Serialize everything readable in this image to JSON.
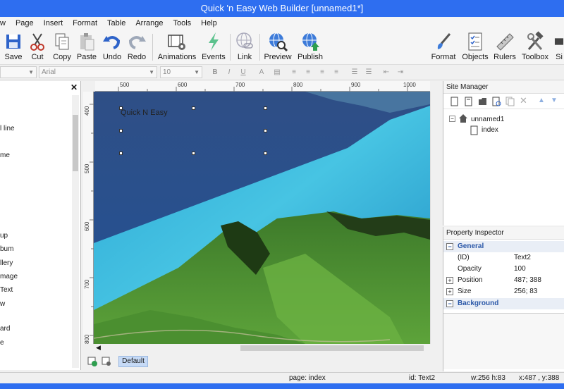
{
  "window": {
    "title": "Quick 'n Easy Web Builder [unnamed1*]"
  },
  "menu": [
    "w",
    "Page",
    "Insert",
    "Format",
    "Table",
    "Arrange",
    "Tools",
    "Help"
  ],
  "toolbar": {
    "save": "Save",
    "cut": "Cut",
    "copy": "Copy",
    "paste": "Paste",
    "undo": "Undo",
    "redo": "Redo",
    "animations": "Animations",
    "events": "Events",
    "link": "Link",
    "preview": "Preview",
    "publish": "Publish",
    "format": "Format",
    "objects": "Objects",
    "rulers": "Rulers",
    "toolbox": "Toolbox",
    "si": "Si"
  },
  "format_bar": {
    "font": "Arial",
    "size": "10"
  },
  "toolbox_items": [
    "l line",
    "me",
    "up",
    "bum",
    "llery",
    "mage",
    "Text",
    "w",
    "ard",
    "e"
  ],
  "rulers": {
    "top": [
      "500",
      "600",
      "700",
      "800",
      "900",
      "1000"
    ],
    "left": [
      "400",
      "500",
      "600",
      "700",
      "800"
    ]
  },
  "canvas": {
    "text": "Quick N Easy"
  },
  "bottom": {
    "default_tab": "Default"
  },
  "site_manager": {
    "title": "Site Manager",
    "root": "unnamed1",
    "page": "index"
  },
  "property_inspector": {
    "title": "Property Inspector",
    "general": "General",
    "rows": [
      {
        "key": "(ID)",
        "value": "Text2"
      },
      {
        "key": "Opacity",
        "value": "100"
      },
      {
        "key": "Position",
        "value": "487; 388"
      },
      {
        "key": "Size",
        "value": "256; 83"
      }
    ],
    "background": "Background"
  },
  "status": {
    "page": "page: index",
    "id": "id: Text2",
    "wh": "w:256 h:83",
    "xy": "x:487 , y:388"
  },
  "colors": {
    "titlebar": "#2e6ef0",
    "selection": "#c6daf6"
  }
}
